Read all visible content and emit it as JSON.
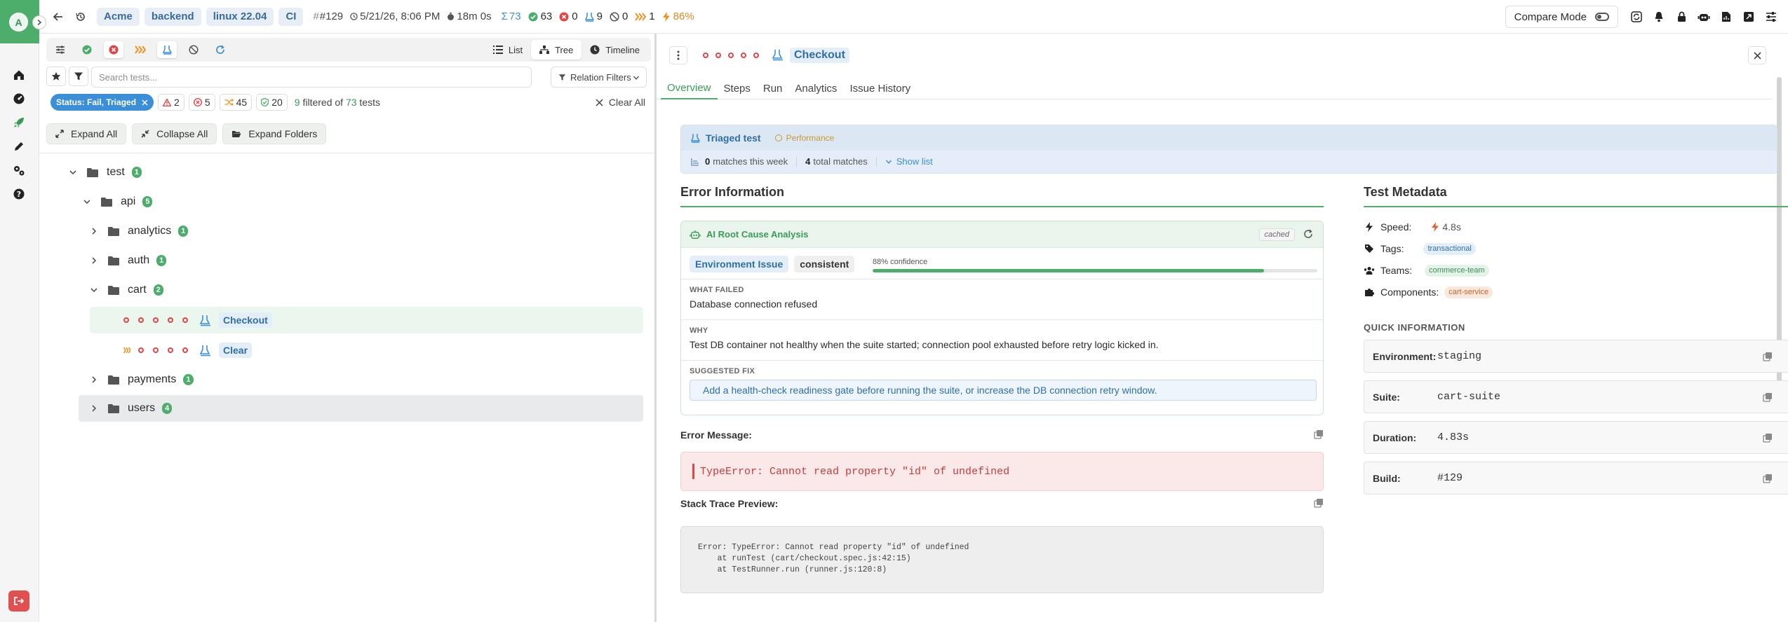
{
  "rail": {
    "avatar_letter": "A"
  },
  "topbar": {
    "chips": [
      "Acme",
      "backend",
      "linux 22.04",
      "CI"
    ],
    "build": "#129",
    "datetime": "5/21/26, 8:06 PM",
    "duration": "18m 0s",
    "stats": {
      "total": "73",
      "passed": "63",
      "failed": "0",
      "skipped": "9",
      "blocked": "0",
      "flaky": "1",
      "rate": "86%"
    },
    "compare_label": "Compare Mode"
  },
  "left": {
    "views": [
      "List",
      "Tree",
      "Timeline"
    ],
    "search_placeholder": "Search tests...",
    "relation_label": "Relation Filters",
    "status_chip": "Status: Fail, Triaged",
    "counts": {
      "warnings": "2",
      "errors": "5",
      "flaky": "45",
      "shield": "20"
    },
    "filtered": {
      "shown": "9",
      "mid": " filtered of ",
      "total": "73",
      "tail": " tests"
    },
    "clear_all": "Clear All",
    "actions": [
      "Expand All",
      "Collapse All",
      "Expand Folders"
    ],
    "tree": {
      "test": {
        "label": "test",
        "count": "1"
      },
      "api": {
        "label": "api",
        "count": "5"
      },
      "analytics": {
        "label": "analytics",
        "count": "1"
      },
      "auth": {
        "label": "auth",
        "count": "1"
      },
      "cart": {
        "label": "cart",
        "count": "2"
      },
      "checkout": "Checkout",
      "clear": "Clear",
      "payments": {
        "label": "payments",
        "count": "1"
      },
      "users": {
        "label": "users",
        "count": "4"
      }
    }
  },
  "right": {
    "title": "Checkout",
    "tabs": [
      "Overview",
      "Steps",
      "Run",
      "Analytics",
      "Issue History"
    ],
    "triage": {
      "label": "Triaged test",
      "category": "Performance",
      "week_count": "0",
      "week_text": "matches this week",
      "total_count": "4",
      "total_text": "total matches",
      "show_list": "Show list"
    },
    "error_info": {
      "heading": "Error Information",
      "ai_title": "AI Root Cause Analysis",
      "cached": "cached",
      "category": "Environment Issue",
      "pattern": "consistent",
      "confidence_label": "88% confidence",
      "confidence": 0.88,
      "what_failed_label": "WHAT FAILED",
      "what_failed": "Database connection refused",
      "why_label": "WHY",
      "why": "Test DB container not healthy when the suite started; connection pool exhausted before retry logic kicked in.",
      "fix_label": "SUGGESTED FIX",
      "fix": "Add a health-check readiness gate before running the suite, or increase the DB connection retry window.",
      "error_message_label": "Error Message:",
      "error_message": "TypeError: Cannot read property \"id\" of undefined",
      "stack_label": "Stack Trace Preview:",
      "stack": "Error: TypeError: Cannot read property \"id\" of undefined\n    at runTest (cart/checkout.spec.js:42:15)\n    at TestRunner.run (runner.js:120:8)"
    },
    "metadata": {
      "heading": "Test Metadata",
      "speed_label": "Speed:",
      "speed": "4.8s",
      "tags_label": "Tags:",
      "tag": "transactional",
      "teams_label": "Teams:",
      "team": "commerce-team",
      "components_label": "Components:",
      "component": "cart-service",
      "quick_heading": "QUICK INFORMATION",
      "quick": [
        {
          "k": "Environment:",
          "v": "staging"
        },
        {
          "k": "Suite:",
          "v": "cart-suite"
        },
        {
          "k": "Duration:",
          "v": "4.83s"
        },
        {
          "k": "Build:",
          "v": "#129"
        }
      ]
    }
  },
  "colors": {
    "accent": "#4cae6a",
    "link": "#3b8fd9",
    "fail": "#e04646",
    "flaky": "#f0901e"
  }
}
